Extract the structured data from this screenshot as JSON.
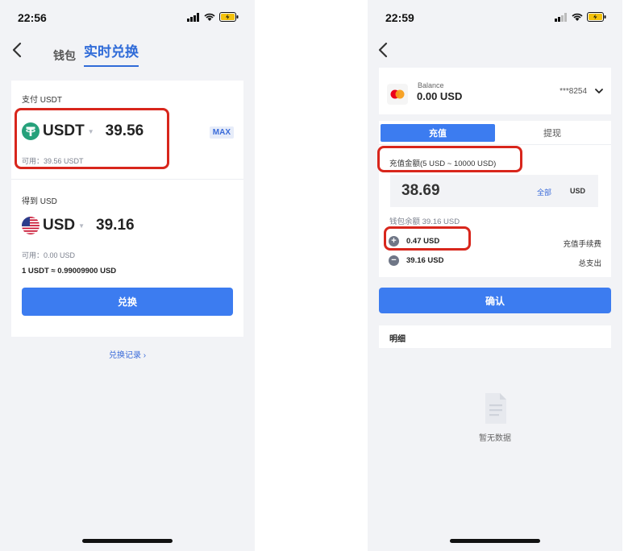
{
  "left": {
    "time": "22:56",
    "tabs": {
      "wallet": "钱包",
      "exchange": "实时兑换"
    },
    "pay": {
      "label": "支付 USDT",
      "coin": "USDT",
      "amount": "39.56",
      "max": "MAX",
      "available": "可用：39.56 USDT"
    },
    "receive": {
      "label": "得到 USD",
      "coin": "USD",
      "amount": "39.16",
      "available": "可用：0.00 USD",
      "rate": "1 USDT ≈ 0.99009900 USD"
    },
    "exchange_button": "兑换",
    "history_link": "兑换记录 ›"
  },
  "right": {
    "time": "22:59",
    "balance": {
      "label": "Balance",
      "value": "0.00 USD",
      "card": "***8254"
    },
    "tabs": {
      "deposit": "充值",
      "withdraw": "提现"
    },
    "amount_label": "充值金额(5 USD ~ 10000 USD)",
    "amount_value": "38.69",
    "all_link": "全部",
    "unit": "USD",
    "wallet_balance": "钱包余额 39.16 USD",
    "fee": {
      "value": "0.47 USD",
      "label": "充值手续费"
    },
    "total": {
      "value": "39.16 USD",
      "label": "总支出"
    },
    "confirm_button": "确认",
    "details_title": "明细",
    "empty_text": "暂无数据"
  },
  "colors": {
    "accent": "#3c7cf0",
    "highlight": "#d8261c",
    "tether": "#26a17b",
    "background": "#f2f3f6"
  },
  "icons": [
    "back-arrow-icon",
    "tether-icon",
    "us-flag-icon",
    "mastercard-icon",
    "chevron-down-icon",
    "plus-circle-icon",
    "minus-circle-icon",
    "empty-document-icon",
    "signal-icon",
    "wifi-icon",
    "battery-icon"
  ]
}
